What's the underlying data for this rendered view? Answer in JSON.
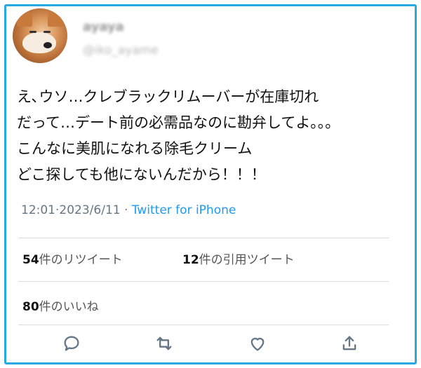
{
  "user": {
    "name": "ayaya",
    "handle": "@iko_ayame"
  },
  "tweet_lines": [
    "え､ウソ…クレブラックリムーバーが在庫切れ",
    "だって…デート前の必需品なのに勘弁してよ｡｡｡",
    "こんなに美肌になれる除毛クリーム",
    "どこ探しても他にないんだから！！！"
  ],
  "meta": {
    "time": "12:01",
    "date": "2023/6/11",
    "sep": "·",
    "source": "Twitter for iPhone"
  },
  "stats": {
    "retweets_count": "54",
    "retweets_label": "件のリツイート",
    "quotes_count": "12",
    "quotes_label": "件の引用ツイート",
    "likes_count": "80",
    "likes_label": "件のいいね"
  },
  "actions": [
    "reply-icon",
    "retweet-icon",
    "like-icon",
    "share-icon"
  ],
  "colors": {
    "frame": "#29a9e1",
    "link": "#1d9bf0",
    "muted": "#657786"
  }
}
